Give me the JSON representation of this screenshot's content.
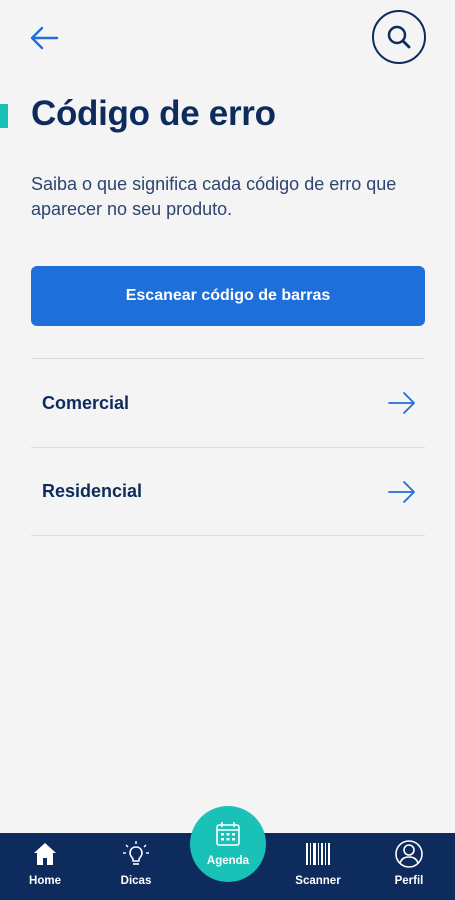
{
  "header": {
    "back_icon": "arrow-left-icon",
    "search_icon": "search-icon"
  },
  "page": {
    "title": "Código de erro",
    "description": "Saiba o que significa cada código de erro que aparecer no seu produto.",
    "accent_color": "#19c1b7"
  },
  "scan_button": {
    "label": "Escanear código de barras",
    "color": "#1e6fd9"
  },
  "categories": [
    {
      "label": "Comercial",
      "icon": "arrow-right-icon"
    },
    {
      "label": "Residencial",
      "icon": "arrow-right-icon"
    }
  ],
  "bottom_nav": {
    "background": "#0d2b5c",
    "items": [
      {
        "label": "Home",
        "icon": "home-icon"
      },
      {
        "label": "Dicas",
        "icon": "lightbulb-icon"
      },
      {
        "label": "Agenda",
        "icon": "calendar-icon"
      },
      {
        "label": "Scanner",
        "icon": "barcode-icon"
      },
      {
        "label": "Perfil",
        "icon": "user-icon"
      }
    ]
  }
}
